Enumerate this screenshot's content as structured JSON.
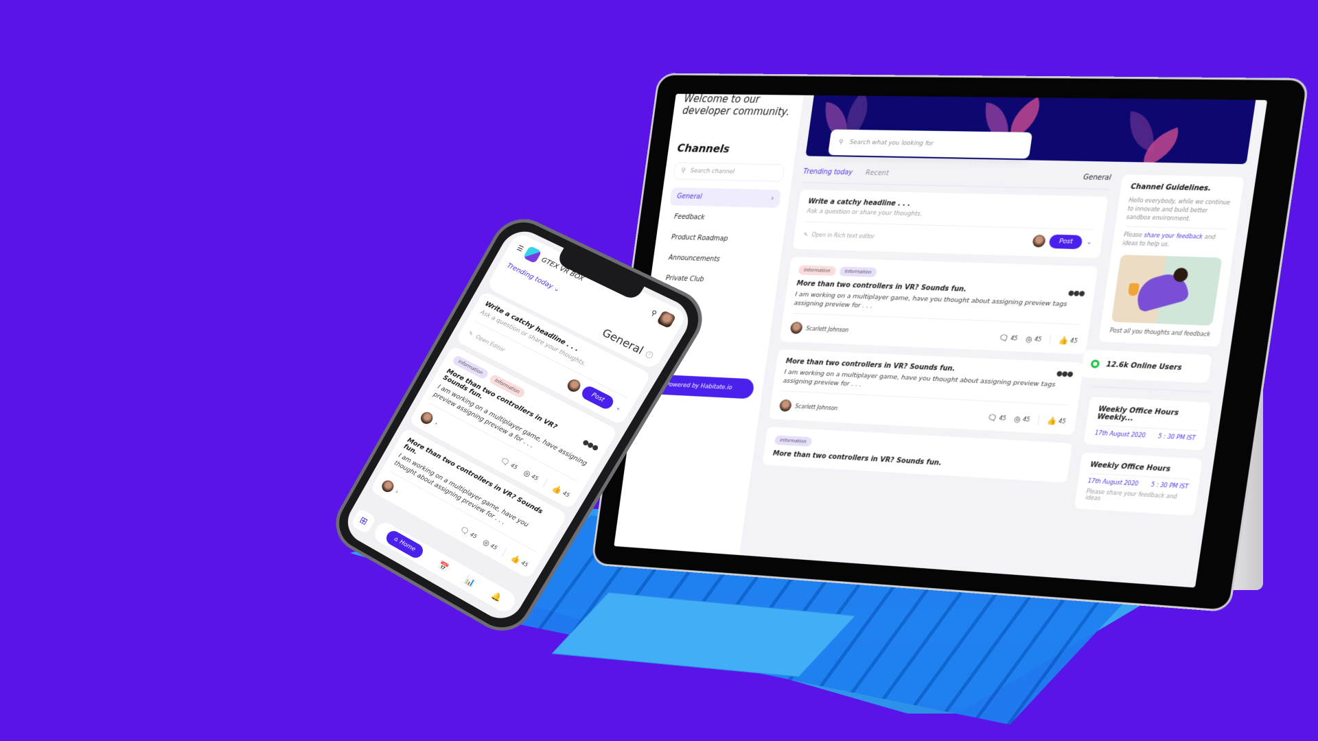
{
  "tablet": {
    "welcome_text": "Welcome to our developer community.",
    "sidebar": {
      "title": "Channels",
      "search_placeholder": "Search channel",
      "items": [
        {
          "label": "General",
          "active": true
        },
        {
          "label": "Feedback"
        },
        {
          "label": "Product Roadmap"
        },
        {
          "label": "Announcements"
        },
        {
          "label": "Private Club"
        }
      ],
      "powered_by": "Powered by Habitate.io"
    },
    "search": {
      "placeholder": "Search what you looking for"
    },
    "tabs": [
      {
        "label": "Trending today",
        "active": true
      },
      {
        "label": "Recent"
      }
    ],
    "channel_label": "General",
    "composer": {
      "headline": "Write a catchy headline . . .",
      "prompt": "Ask a question or share your thoughts.",
      "rich_editor": "Open in Rich text editor",
      "post_label": "Post"
    },
    "posts": [
      {
        "tags": [
          {
            "label": "Information",
            "color": "pink"
          },
          {
            "label": "Information",
            "color": "purple"
          }
        ],
        "title": "More than two controllers in VR? Sounds fun.",
        "body": "I am working on a multiplayer game, have you thought about assigning preview tags assigning preview  for . . .",
        "author": "Scarlett Johnson",
        "comments": "45",
        "views": "45",
        "likes": "45"
      },
      {
        "tags": [],
        "title": "More than two controllers in VR? Sounds fun.",
        "body": "I am working on a multiplayer game, have you thought about assigning preview tags assigning preview  for . . .",
        "author": "Scarlett Johnson",
        "comments": "45",
        "views": "45",
        "likes": "45"
      },
      {
        "tags": [
          {
            "label": "Information",
            "color": "purple"
          }
        ],
        "title": "More than two controllers in VR? Sounds fun."
      }
    ],
    "guidelines": {
      "title": "Channel Guidelines.",
      "text": "Hello everybody, while we continue to innovate and build better sandbox environment.",
      "please": "Please ",
      "link": "share your feedback",
      "rest": " and ideas to help us.",
      "footer": "Post all you thoughts and feedback"
    },
    "online_users": "12.6k Online Users",
    "events": [
      {
        "title": "Weekly Office Hours Weekly...",
        "date": "17th August 2020",
        "time": "5 : 30 PM IST"
      },
      {
        "title": "Weekly Office Hours",
        "date": "17th August 2020",
        "time": "5 : 30 PM IST",
        "note": "Please share your feedback and ideas"
      }
    ]
  },
  "phone": {
    "app_name": "GTEX VR BOX",
    "trending": "Trending today",
    "channel": "General",
    "composer": {
      "headline": "Write a catchy headline . . .",
      "prompt": "Ask a question or share your thoughts.",
      "editor": "Open Editor",
      "post_label": "Post"
    },
    "posts": [
      {
        "tags": [
          {
            "label": "Information",
            "color": "purple"
          },
          {
            "label": "Information",
            "color": "pink"
          }
        ],
        "title": "More than two controllers in VR? Sounds fun.",
        "body": "I am working on a multiplayer game, have assigning preview assigning preview a for . . .",
        "comments": "45",
        "views": "45",
        "likes": "45"
      },
      {
        "title": "More than two controllers in VR? Sounds fun.",
        "body": "I am working on a multiplayer game, have you thought about  assigning preview  for . . .",
        "comments": "45",
        "views": "45",
        "likes": "45"
      }
    ],
    "nav": {
      "home": "Home"
    }
  },
  "colors": {
    "background": "#5a14e8",
    "accent": "#4a20ec",
    "keyboard": "#2f9af1",
    "online": "#16c23a",
    "banner": "#0c0870"
  }
}
